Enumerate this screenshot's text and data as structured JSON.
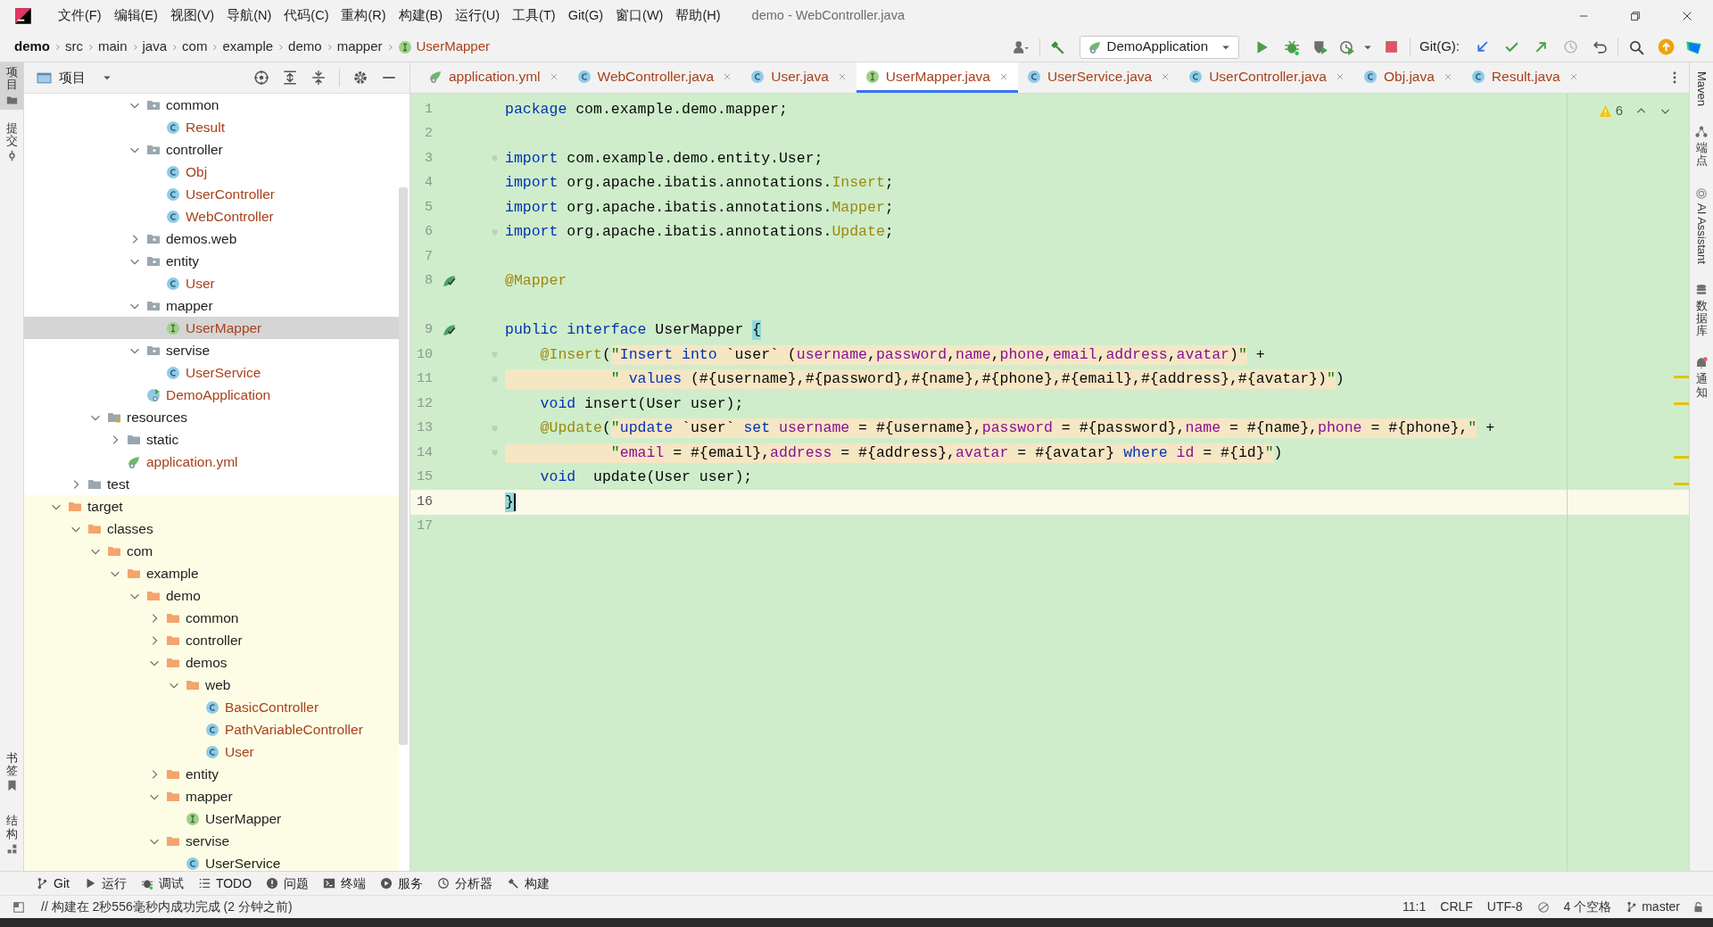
{
  "window": {
    "title": "demo - WebController.java"
  },
  "menu": [
    "文件(F)",
    "编辑(E)",
    "视图(V)",
    "导航(N)",
    "代码(C)",
    "重构(R)",
    "构建(B)",
    "运行(U)",
    "工具(T)",
    "Git(G)",
    "窗口(W)",
    "帮助(H)"
  ],
  "breadcrumb": [
    {
      "label": "demo",
      "kind": "project"
    },
    {
      "label": "src",
      "kind": "folder"
    },
    {
      "label": "main",
      "kind": "folder"
    },
    {
      "label": "java",
      "kind": "folder"
    },
    {
      "label": "com",
      "kind": "folder"
    },
    {
      "label": "example",
      "kind": "folder"
    },
    {
      "label": "demo",
      "kind": "folder"
    },
    {
      "label": "mapper",
      "kind": "folder"
    },
    {
      "label": "UserMapper",
      "kind": "interface"
    }
  ],
  "toolbar": {
    "run_config": "DemoApplication",
    "git_label": "Git(G):"
  },
  "left_tools": {
    "top": [
      {
        "label": "项目",
        "selected": true
      },
      {
        "label": "提交",
        "selected": false
      }
    ],
    "bottom": [
      {
        "label": "书签",
        "selected": false
      },
      {
        "label": "结构",
        "selected": false
      }
    ]
  },
  "right_tools": [
    {
      "label": "Maven",
      "kind": "maven"
    },
    {
      "label": "端点",
      "kind": "endpoints"
    },
    {
      "label": "AI Assistant",
      "kind": "ai"
    },
    {
      "label": "数据库",
      "kind": "database"
    },
    {
      "label": "通知",
      "kind": "notifications"
    }
  ],
  "project_panel": {
    "title": "项目",
    "tree": [
      {
        "children": [
          {
            "children": [
              {
                "children": [
                  {
                    "children": [
                      {
                        "label": "common",
                        "kind": "package",
                        "expanded": true,
                        "selected": false,
                        "modified": false,
                        "children": [
                          {
                            "label": "Result",
                            "kind": "class",
                            "selected": false,
                            "modified": true
                          }
                        ]
                      },
                      {
                        "label": "controller",
                        "kind": "package",
                        "expanded": true,
                        "selected": false,
                        "modified": false,
                        "children": [
                          {
                            "label": "Obj",
                            "kind": "class",
                            "selected": false,
                            "modified": true
                          },
                          {
                            "label": "UserController",
                            "kind": "class",
                            "selected": false,
                            "modified": true
                          },
                          {
                            "label": "WebController",
                            "kind": "class",
                            "selected": false,
                            "modified": true
                          }
                        ]
                      },
                      {
                        "label": "demos.web",
                        "kind": "package",
                        "expanded": false,
                        "selected": false,
                        "modified": false
                      },
                      {
                        "label": "entity",
                        "kind": "package",
                        "expanded": true,
                        "selected": false,
                        "modified": false,
                        "children": [
                          {
                            "label": "User",
                            "kind": "class",
                            "selected": false,
                            "modified": true
                          }
                        ]
                      },
                      {
                        "label": "mapper",
                        "kind": "package",
                        "expanded": true,
                        "selected": false,
                        "modified": false,
                        "children": [
                          {
                            "label": "UserMapper",
                            "kind": "interface",
                            "selected": true,
                            "modified": true
                          }
                        ]
                      },
                      {
                        "label": "servise",
                        "kind": "package",
                        "expanded": true,
                        "selected": false,
                        "modified": false,
                        "children": [
                          {
                            "label": "UserService",
                            "kind": "class",
                            "selected": false,
                            "modified": true
                          }
                        ]
                      },
                      {
                        "label": "DemoApplication",
                        "kind": "app",
                        "selected": false,
                        "modified": true
                      }
                    ]
                  }
                ]
              },
              {
                "label": "resources",
                "kind": "resources",
                "expanded": true,
                "selected": false,
                "modified": false,
                "children": [
                  {
                    "label": "static",
                    "kind": "folder",
                    "expanded": false,
                    "selected": false,
                    "modified": false
                  },
                  {
                    "label": "application.yml",
                    "kind": "yml",
                    "selected": false,
                    "modified": true
                  }
                ]
              }
            ]
          },
          {
            "label": "test",
            "kind": "folder",
            "expanded": false,
            "selected": false,
            "modified": false,
            "excluded": false
          }
        ]
      },
      {
        "label": "target",
        "kind": "excluded",
        "expanded": true,
        "selected": false,
        "modified": false,
        "excluded": true,
        "children": [
          {
            "label": "classes",
            "kind": "excluded",
            "expanded": true,
            "selected": false,
            "modified": false,
            "children": [
              {
                "label": "com",
                "kind": "excluded",
                "expanded": true,
                "selected": false,
                "modified": false,
                "children": [
                  {
                    "label": "example",
                    "kind": "excluded",
                    "expanded": true,
                    "selected": false,
                    "modified": false,
                    "children": [
                      {
                        "label": "demo",
                        "kind": "excluded",
                        "expanded": true,
                        "selected": false,
                        "modified": false,
                        "children": [
                          {
                            "label": "common",
                            "kind": "excluded",
                            "expanded": false,
                            "selected": false,
                            "modified": false
                          },
                          {
                            "label": "controller",
                            "kind": "excluded",
                            "expanded": false,
                            "selected": false,
                            "modified": false
                          },
                          {
                            "label": "demos",
                            "kind": "excluded",
                            "expanded": true,
                            "selected": false,
                            "modified": false,
                            "children": [
                              {
                                "label": "web",
                                "kind": "excluded",
                                "expanded": true,
                                "selected": false,
                                "modified": false,
                                "children": [
                                  {
                                    "label": "BasicController",
                                    "kind": "class",
                                    "selected": false,
                                    "modified": true
                                  },
                                  {
                                    "label": "PathVariableController",
                                    "kind": "class",
                                    "selected": false,
                                    "modified": true
                                  },
                                  {
                                    "label": "User",
                                    "kind": "class",
                                    "selected": false,
                                    "modified": true
                                  }
                                ]
                              }
                            ]
                          },
                          {
                            "label": "entity",
                            "kind": "excluded",
                            "expanded": false,
                            "selected": false,
                            "modified": false
                          },
                          {
                            "label": "mapper",
                            "kind": "excluded",
                            "expanded": true,
                            "selected": false,
                            "modified": false,
                            "children": [
                              {
                                "label": "UserMapper",
                                "kind": "interface",
                                "selected": false,
                                "modified": false
                              }
                            ]
                          },
                          {
                            "label": "servise",
                            "kind": "excluded",
                            "expanded": true,
                            "selected": false,
                            "modified": false,
                            "children": [
                              {
                                "label": "UserService",
                                "kind": "class",
                                "selected": false,
                                "modified": false
                              }
                            ]
                          }
                        ]
                      }
                    ]
                  }
                ]
              }
            ]
          }
        ]
      }
    ]
  },
  "tabs": [
    {
      "label": "application.yml",
      "kind": "yml",
      "selected": false
    },
    {
      "label": "WebController.java",
      "kind": "class",
      "selected": false
    },
    {
      "label": "User.java",
      "kind": "class",
      "selected": false
    },
    {
      "label": "UserMapper.java",
      "kind": "interface",
      "selected": true
    },
    {
      "label": "UserService.java",
      "kind": "class",
      "selected": false
    },
    {
      "label": "UserController.java",
      "kind": "class",
      "selected": false
    },
    {
      "label": "Obj.java",
      "kind": "class",
      "selected": false
    },
    {
      "label": "Result.java",
      "kind": "class",
      "selected": false
    }
  ],
  "editor": {
    "warnings": "6",
    "lines": [
      {
        "number": "1",
        "current": false,
        "tokens": [
          {
            "kind": "kw",
            "text": "package"
          },
          {
            "kind": "plain",
            "text": " com.example.demo.mapper;"
          }
        ]
      },
      {
        "number": "2",
        "current": false
      },
      {
        "number": "3",
        "current": false,
        "fold": true,
        "tokens": [
          {
            "kind": "kw",
            "text": "import"
          },
          {
            "kind": "plain",
            "text": " com.example.demo.entity.User;"
          }
        ]
      },
      {
        "number": "4",
        "current": false,
        "tokens": [
          {
            "kind": "kw",
            "text": "import"
          },
          {
            "kind": "plain",
            "text": " org.apache.ibatis.annotations."
          },
          {
            "kind": "ann",
            "text": "Insert"
          },
          {
            "kind": "plain",
            "text": ";"
          }
        ]
      },
      {
        "number": "5",
        "current": false,
        "tokens": [
          {
            "kind": "kw",
            "text": "import"
          },
          {
            "kind": "plain",
            "text": " org.apache.ibatis.annotations."
          },
          {
            "kind": "ann",
            "text": "Mapper"
          },
          {
            "kind": "plain",
            "text": ";"
          }
        ]
      },
      {
        "number": "6",
        "current": false,
        "fold": true,
        "tokens": [
          {
            "kind": "kw",
            "text": "import"
          },
          {
            "kind": "plain",
            "text": " org.apache.ibatis.annotations."
          },
          {
            "kind": "ann",
            "text": "Update"
          },
          {
            "kind": "plain",
            "text": ";"
          }
        ]
      },
      {
        "number": "7",
        "current": false
      },
      {
        "number": "8",
        "current": false,
        "gutter_icon": true,
        "tokens": [
          {
            "kind": "ann",
            "text": "@Mapper"
          }
        ]
      },
      {
        "number": "9",
        "current": false,
        "gutter_icon": true,
        "tokens": [
          {
            "kind": "kw",
            "text": "public "
          },
          {
            "kind": "kw",
            "text": "interface"
          },
          {
            "kind": "plain",
            "text": " UserMapper "
          },
          {
            "kind": "match",
            "text": "{"
          }
        ]
      },
      {
        "number": "10",
        "current": false,
        "fold": true,
        "tokens": [
          {
            "kind": "ann",
            "text": "    @Insert"
          },
          {
            "kind": "plain",
            "text": "("
          },
          {
            "kind": "quote",
            "text": "\""
          },
          {
            "kind": "sqlkw",
            "text": "Insert into"
          },
          {
            "kind": "sql",
            "text": " `user` ("
          },
          {
            "kind": "sqlid",
            "text": "username"
          },
          {
            "kind": "sql",
            "text": ","
          },
          {
            "kind": "sqlid",
            "text": "password"
          },
          {
            "kind": "sql",
            "text": ","
          },
          {
            "kind": "sqlid",
            "text": "name"
          },
          {
            "kind": "sql",
            "text": ","
          },
          {
            "kind": "sqlid",
            "text": "phone"
          },
          {
            "kind": "sql",
            "text": ","
          },
          {
            "kind": "sqlid",
            "text": "email"
          },
          {
            "kind": "sql",
            "text": ","
          },
          {
            "kind": "sqlid",
            "text": "address"
          },
          {
            "kind": "sql",
            "text": ","
          },
          {
            "kind": "sqlid",
            "text": "avatar"
          },
          {
            "kind": "sql",
            "text": ")"
          },
          {
            "kind": "quote",
            "text": "\""
          },
          {
            "kind": "plain",
            "text": " +"
          }
        ]
      },
      {
        "number": "11",
        "current": false,
        "fold": true,
        "tokens": [
          {
            "kind": "quote",
            "text": "            \""
          },
          {
            "kind": "sqlkw",
            "text": " values"
          },
          {
            "kind": "sql",
            "text": " (#{username},#{password},#{name},#{phone},#{email},#{address},#{avatar})"
          },
          {
            "kind": "quote",
            "text": "\""
          },
          {
            "kind": "plain",
            "text": ")"
          }
        ]
      },
      {
        "number": "12",
        "current": false,
        "tokens": [
          {
            "kind": "kw",
            "text": "    void"
          },
          {
            "kind": "plain",
            "text": " insert(User user);"
          }
        ]
      },
      {
        "number": "13",
        "current": false,
        "fold": true,
        "tokens": [
          {
            "kind": "ann",
            "text": "    @Update"
          },
          {
            "kind": "plain",
            "text": "("
          },
          {
            "kind": "quote",
            "text": "\""
          },
          {
            "kind": "sqlkw",
            "text": "update"
          },
          {
            "kind": "sql",
            "text": " `user` "
          },
          {
            "kind": "sqlkw",
            "text": "set "
          },
          {
            "kind": "sqlid",
            "text": "username"
          },
          {
            "kind": "sql",
            "text": " = #{username},"
          },
          {
            "kind": "sqlid",
            "text": "password"
          },
          {
            "kind": "sql",
            "text": " = #{password},"
          },
          {
            "kind": "sqlid",
            "text": "name"
          },
          {
            "kind": "sql",
            "text": " = #{name},"
          },
          {
            "kind": "sqlid",
            "text": "phone"
          },
          {
            "kind": "sql",
            "text": " = #{phone},"
          },
          {
            "kind": "quote",
            "text": "\""
          },
          {
            "kind": "plain",
            "text": " +"
          }
        ]
      },
      {
        "number": "14",
        "current": false,
        "fold": true,
        "tokens": [
          {
            "kind": "quote",
            "text": "            \""
          },
          {
            "kind": "sqlid",
            "text": "email"
          },
          {
            "kind": "sql",
            "text": " = #{email},"
          },
          {
            "kind": "sqlid",
            "text": "address"
          },
          {
            "kind": "sql",
            "text": " = #{address},"
          },
          {
            "kind": "sqlid",
            "text": "avatar"
          },
          {
            "kind": "sql",
            "text": " = #{avatar} "
          },
          {
            "kind": "sqlkw",
            "text": "where "
          },
          {
            "kind": "sqlid",
            "text": "id"
          },
          {
            "kind": "sql",
            "text": " = #{id}"
          },
          {
            "kind": "quote",
            "text": "\""
          },
          {
            "kind": "plain",
            "text": ")"
          }
        ]
      },
      {
        "number": "15",
        "current": false,
        "tokens": [
          {
            "kind": "kw",
            "text": "    void"
          },
          {
            "kind": "plain",
            "text": "  update(User user);"
          }
        ]
      },
      {
        "number": "16",
        "current": true,
        "tokens": [
          {
            "kind": "match",
            "text": "}"
          }
        ]
      },
      {
        "number": "17",
        "current": false
      }
    ]
  },
  "bottom_tools": [
    {
      "label": "Git",
      "kind": "git"
    },
    {
      "label": "运行",
      "kind": "run"
    },
    {
      "label": "调试",
      "kind": "debug"
    },
    {
      "label": "TODO",
      "kind": "todo"
    },
    {
      "label": "问题",
      "kind": "problems"
    },
    {
      "label": "终端",
      "kind": "terminal"
    },
    {
      "label": "服务",
      "kind": "services"
    },
    {
      "label": "分析器",
      "kind": "profiler"
    },
    {
      "label": "构建",
      "kind": "build"
    }
  ],
  "status_bar": {
    "message": "// 构建在 2秒556毫秒内成功完成 (2 分钟之前)",
    "items": [
      {
        "label": "11:1",
        "kind": "position"
      },
      {
        "label": "CRLF",
        "kind": "separator"
      },
      {
        "label": "UTF-8",
        "kind": "encoding"
      },
      {
        "label": "4 个空格",
        "kind": "indent"
      },
      {
        "label": "master",
        "kind": "branch"
      }
    ]
  }
}
